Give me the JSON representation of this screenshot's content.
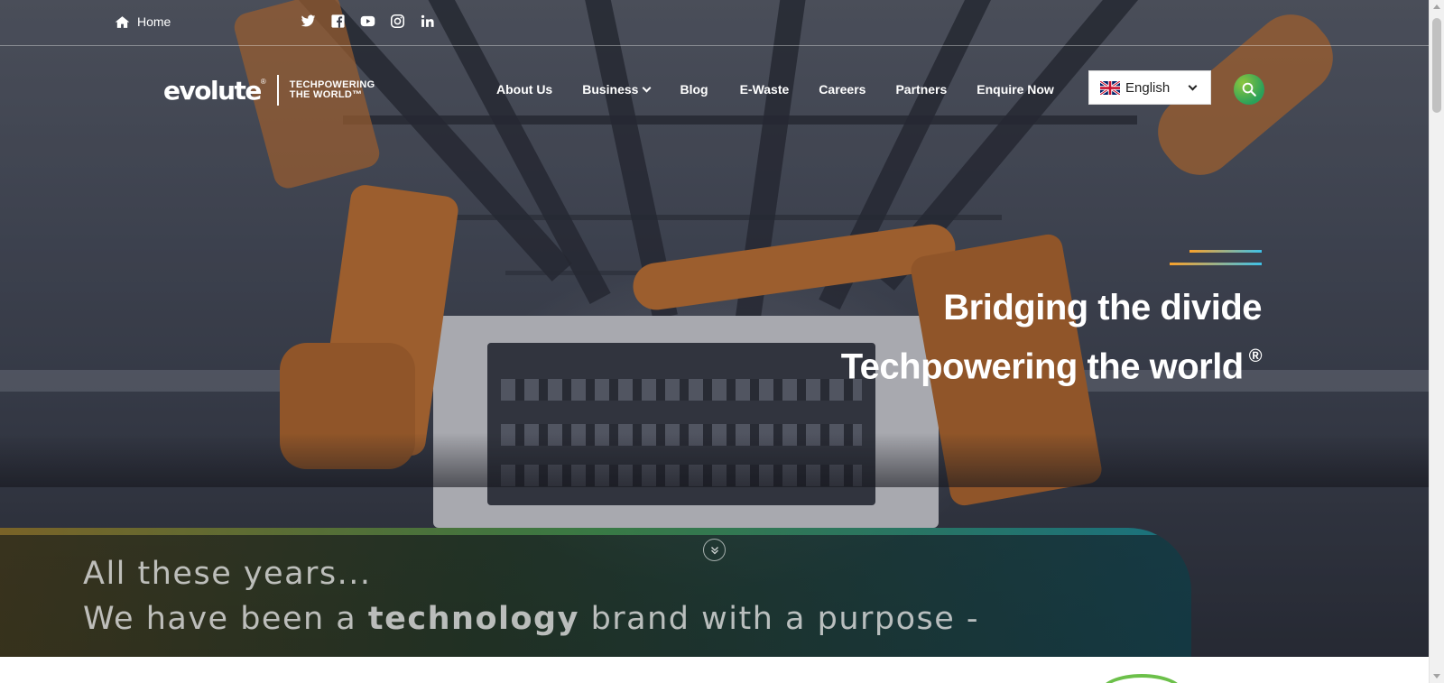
{
  "topbar": {
    "home_label": "Home",
    "social_icons": [
      "twitter-icon",
      "facebook-icon",
      "youtube-icon",
      "instagram-icon",
      "linkedin-icon"
    ]
  },
  "logo": {
    "word": "evolute",
    "reg": "®",
    "tagline_1": "TECHPOWERING",
    "tagline_2": "THE WORLD™"
  },
  "nav": {
    "items": [
      {
        "label": "About Us"
      },
      {
        "label": "Business"
      },
      {
        "label": "Blog"
      },
      {
        "label": "E-Waste"
      },
      {
        "label": "Careers"
      },
      {
        "label": "Partners"
      },
      {
        "label": "Enquire Now"
      }
    ]
  },
  "language": {
    "selected": "English",
    "flag_icon": "uk-flag-icon"
  },
  "hero": {
    "headline_1": "Bridging the divide",
    "headline_2": "Techpowering the world",
    "headline_reg": "®"
  },
  "banner": {
    "line_1": "All these years...",
    "line_2_pre": "We have been a",
    "line_2_bold": "technology",
    "line_2_post": "brand with a purpose -"
  },
  "colors": {
    "accent_orange": "#f9a12a",
    "accent_blue": "#3ec1e8",
    "search_green": "#2aa15a"
  }
}
